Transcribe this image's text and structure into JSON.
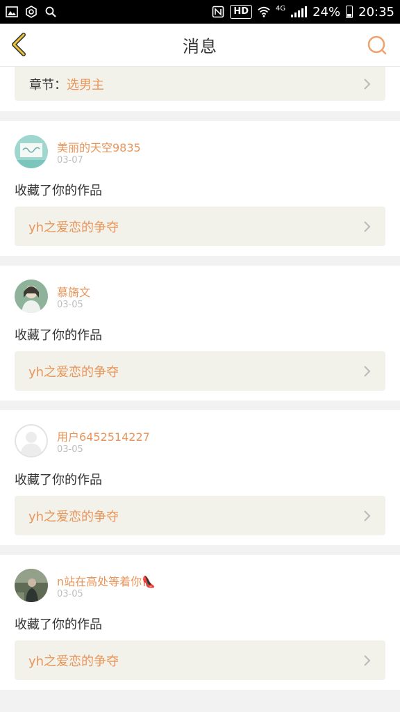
{
  "status_bar": {
    "hd": "HD",
    "network": "4G",
    "battery": "24%",
    "time": "20:35"
  },
  "nav": {
    "title": "消息",
    "accent_color": "#e8c338",
    "search_color": "#f0a06a"
  },
  "partial_item": {
    "prefix": "章节：",
    "chapter": "选男主"
  },
  "items": [
    {
      "username": "美丽的天空9835",
      "date": "03-07",
      "action": "收藏了你的作品",
      "work": "yh之爱恋的争夺",
      "avatar": "avatar-whiteboard"
    },
    {
      "username": "慕旖文",
      "date": "03-05",
      "action": "收藏了你的作品",
      "work": "yh之爱恋的争夺",
      "avatar": "avatar-girl"
    },
    {
      "username": "用户6452514227",
      "date": "03-05",
      "action": "收藏了你的作品",
      "work": "yh之爱恋的争夺",
      "avatar": "avatar-default"
    },
    {
      "username": "n站在高处等着你👠",
      "date": "03-05",
      "action": "收藏了你的作品",
      "work": "yh之爱恋的争夺",
      "avatar": "avatar-photo"
    }
  ]
}
